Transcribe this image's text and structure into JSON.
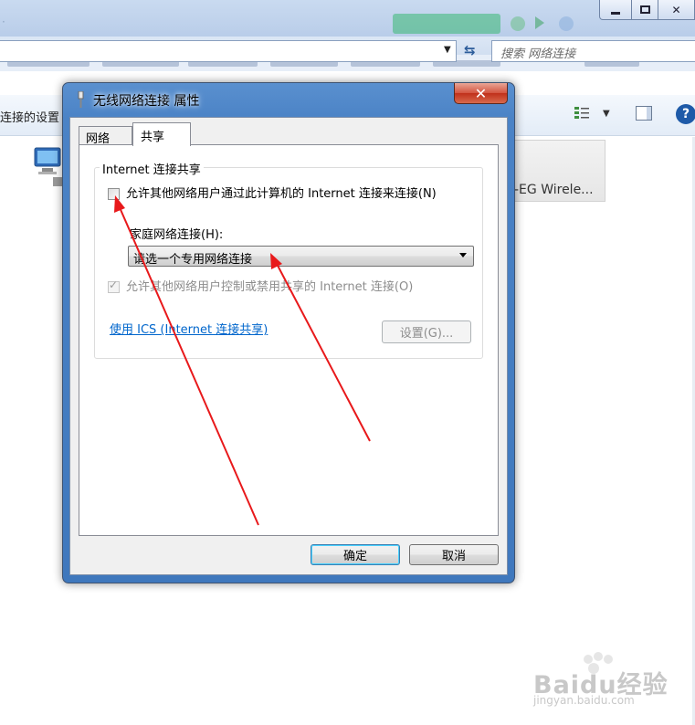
{
  "background_window": {
    "search_placeholder": "搜索 网络连接",
    "cmd_text": "连接的设置",
    "adapter_name": "-EG Wirele...",
    "help_label": "?"
  },
  "dialog": {
    "title": "无线网络连接 属性",
    "close_label": "✕",
    "tabs": [
      {
        "label": "网络",
        "active": false
      },
      {
        "label": "共享",
        "active": true
      }
    ],
    "group_title": "Internet 连接共享",
    "allow_share": {
      "label": "允许其他网络用户通过此计算机的 Internet 连接来连接(N)",
      "checked": false
    },
    "home_network_label": "家庭网络连接(H):",
    "home_network_select": "请选一个专用网络连接",
    "allow_control": {
      "label": "允许其他网络用户控制或禁用共享的 Internet 连接(O)",
      "checked": true,
      "disabled": true
    },
    "ics_link": "使用 ICS (Internet 连接共享)",
    "settings_button": "设置(G)...",
    "ok_button": "确定",
    "cancel_button": "取消"
  },
  "watermark": {
    "text": "Baidu经验",
    "sub": "jingyan.baidu.com"
  },
  "colors": {
    "dialog_frame": "#4b83c6",
    "close_red": "#c0301b",
    "link": "#0066cc",
    "annotation_arrow": "#e8191b"
  }
}
